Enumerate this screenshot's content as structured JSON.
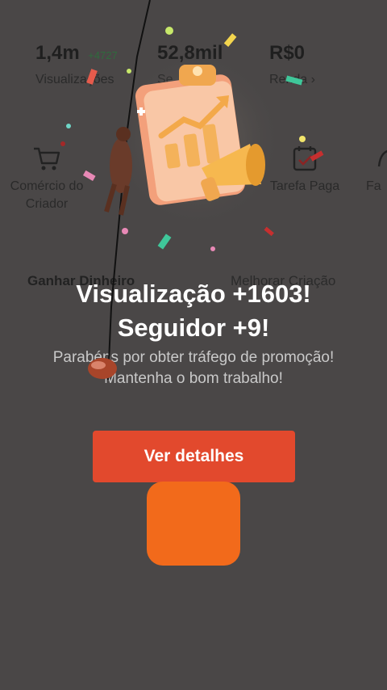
{
  "stats": [
    {
      "value": "1,4m",
      "delta": "+4727",
      "label": "Visualizações"
    },
    {
      "value": "52,8mil",
      "label": "Se"
    },
    {
      "value": "R$0",
      "label": "Renda ›"
    }
  ],
  "tools": [
    {
      "icon": "cart-icon",
      "label": "Comércio do Criador"
    },
    {
      "icon": "task-icon",
      "label": "Tarefa Paga"
    },
    {
      "icon": "fan-icon",
      "label": "Fa"
    }
  ],
  "sections": {
    "left": "Ganhar Dinheiro",
    "right": "Melhorar Criação"
  },
  "modal": {
    "title_line1": "Visualização +1603!",
    "title_line2": "Seguidor +9!",
    "description": "Parabéns por obter tráfego de promoção! Mantenha o bom trabalho!",
    "button_label": "Ver detalhes",
    "illustration": "clipboard-chart-megaphone-icon"
  },
  "colors": {
    "accent_button": "#e2492d",
    "orange_block": "#f26a1b",
    "overlay": "#4a4747"
  }
}
